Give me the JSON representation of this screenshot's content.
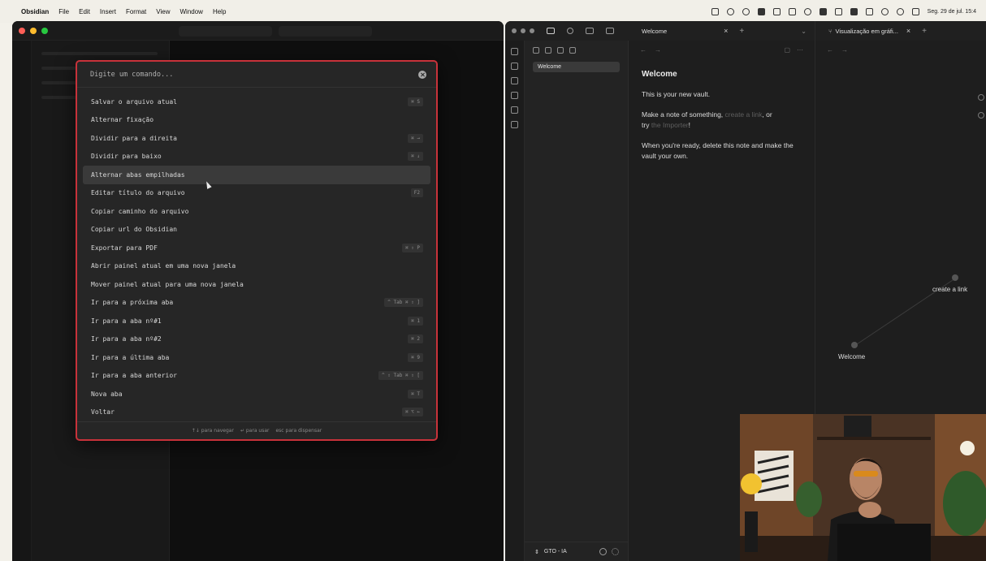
{
  "menubar": {
    "app": "Obsidian",
    "menus": [
      "File",
      "Edit",
      "Insert",
      "Format",
      "View",
      "Window",
      "Help"
    ],
    "clock": "Seg. 29 de jul. 15:4"
  },
  "palette": {
    "placeholder": "Digite um comando...",
    "items": [
      {
        "label": "Salvar o arquivo atual",
        "hotkey": "⌘ S"
      },
      {
        "label": "Alternar fixação",
        "hotkey": ""
      },
      {
        "label": "Dividir para a direita",
        "hotkey": "⌘ →"
      },
      {
        "label": "Dividir para baixo",
        "hotkey": "⌘ ↓"
      },
      {
        "label": "Alternar abas empilhadas",
        "hotkey": ""
      },
      {
        "label": "Editar título do arquivo",
        "hotkey": "F2"
      },
      {
        "label": "Copiar caminho do arquivo",
        "hotkey": ""
      },
      {
        "label": "Copiar url do Obsidian",
        "hotkey": ""
      },
      {
        "label": "Exportar para PDF",
        "hotkey": "⌘ ⇧ P"
      },
      {
        "label": "Abrir painel atual em uma nova janela",
        "hotkey": ""
      },
      {
        "label": "Mover painel atual para uma nova janela",
        "hotkey": ""
      },
      {
        "label": "Ir para a próxima aba",
        "hotkey": "^ Tab  ⌘ ⇧ ]"
      },
      {
        "label": "Ir para a aba nº#1",
        "hotkey": "⌘ 1"
      },
      {
        "label": "Ir para a aba nº#2",
        "hotkey": "⌘ 2"
      },
      {
        "label": "Ir para a última aba",
        "hotkey": "⌘ 9"
      },
      {
        "label": "Ir para a aba anterior",
        "hotkey": "^ ⇧ Tab  ⌘ ⇧ ["
      },
      {
        "label": "Nova aba",
        "hotkey": "⌘ T"
      },
      {
        "label": "Voltar",
        "hotkey": "⌘ ⌥ ←"
      }
    ],
    "active_index": 4,
    "footer": {
      "navigate": "↑↓ para navegar",
      "use": "↵ para usar",
      "dismiss": "esc para dispensar"
    }
  },
  "right_window": {
    "file_explorer": {
      "items": [
        "Welcome"
      ]
    },
    "vault_name": "GTO - IA",
    "tab1": {
      "title": "Welcome"
    },
    "tab2": {
      "title": "Visualização em gráfi..."
    },
    "note": {
      "title": "Welcome",
      "p1": "This is your new vault.",
      "p2a": "Make a note of something, ",
      "p2link1": "create a link",
      "p2b": ", or",
      "p2c": "try ",
      "p2link2": "the Importer",
      "p2d": "!",
      "p3": "When you're ready, delete this note and make the vault your own."
    },
    "graph": {
      "nodes": [
        "create a link",
        "Welcome"
      ]
    }
  }
}
